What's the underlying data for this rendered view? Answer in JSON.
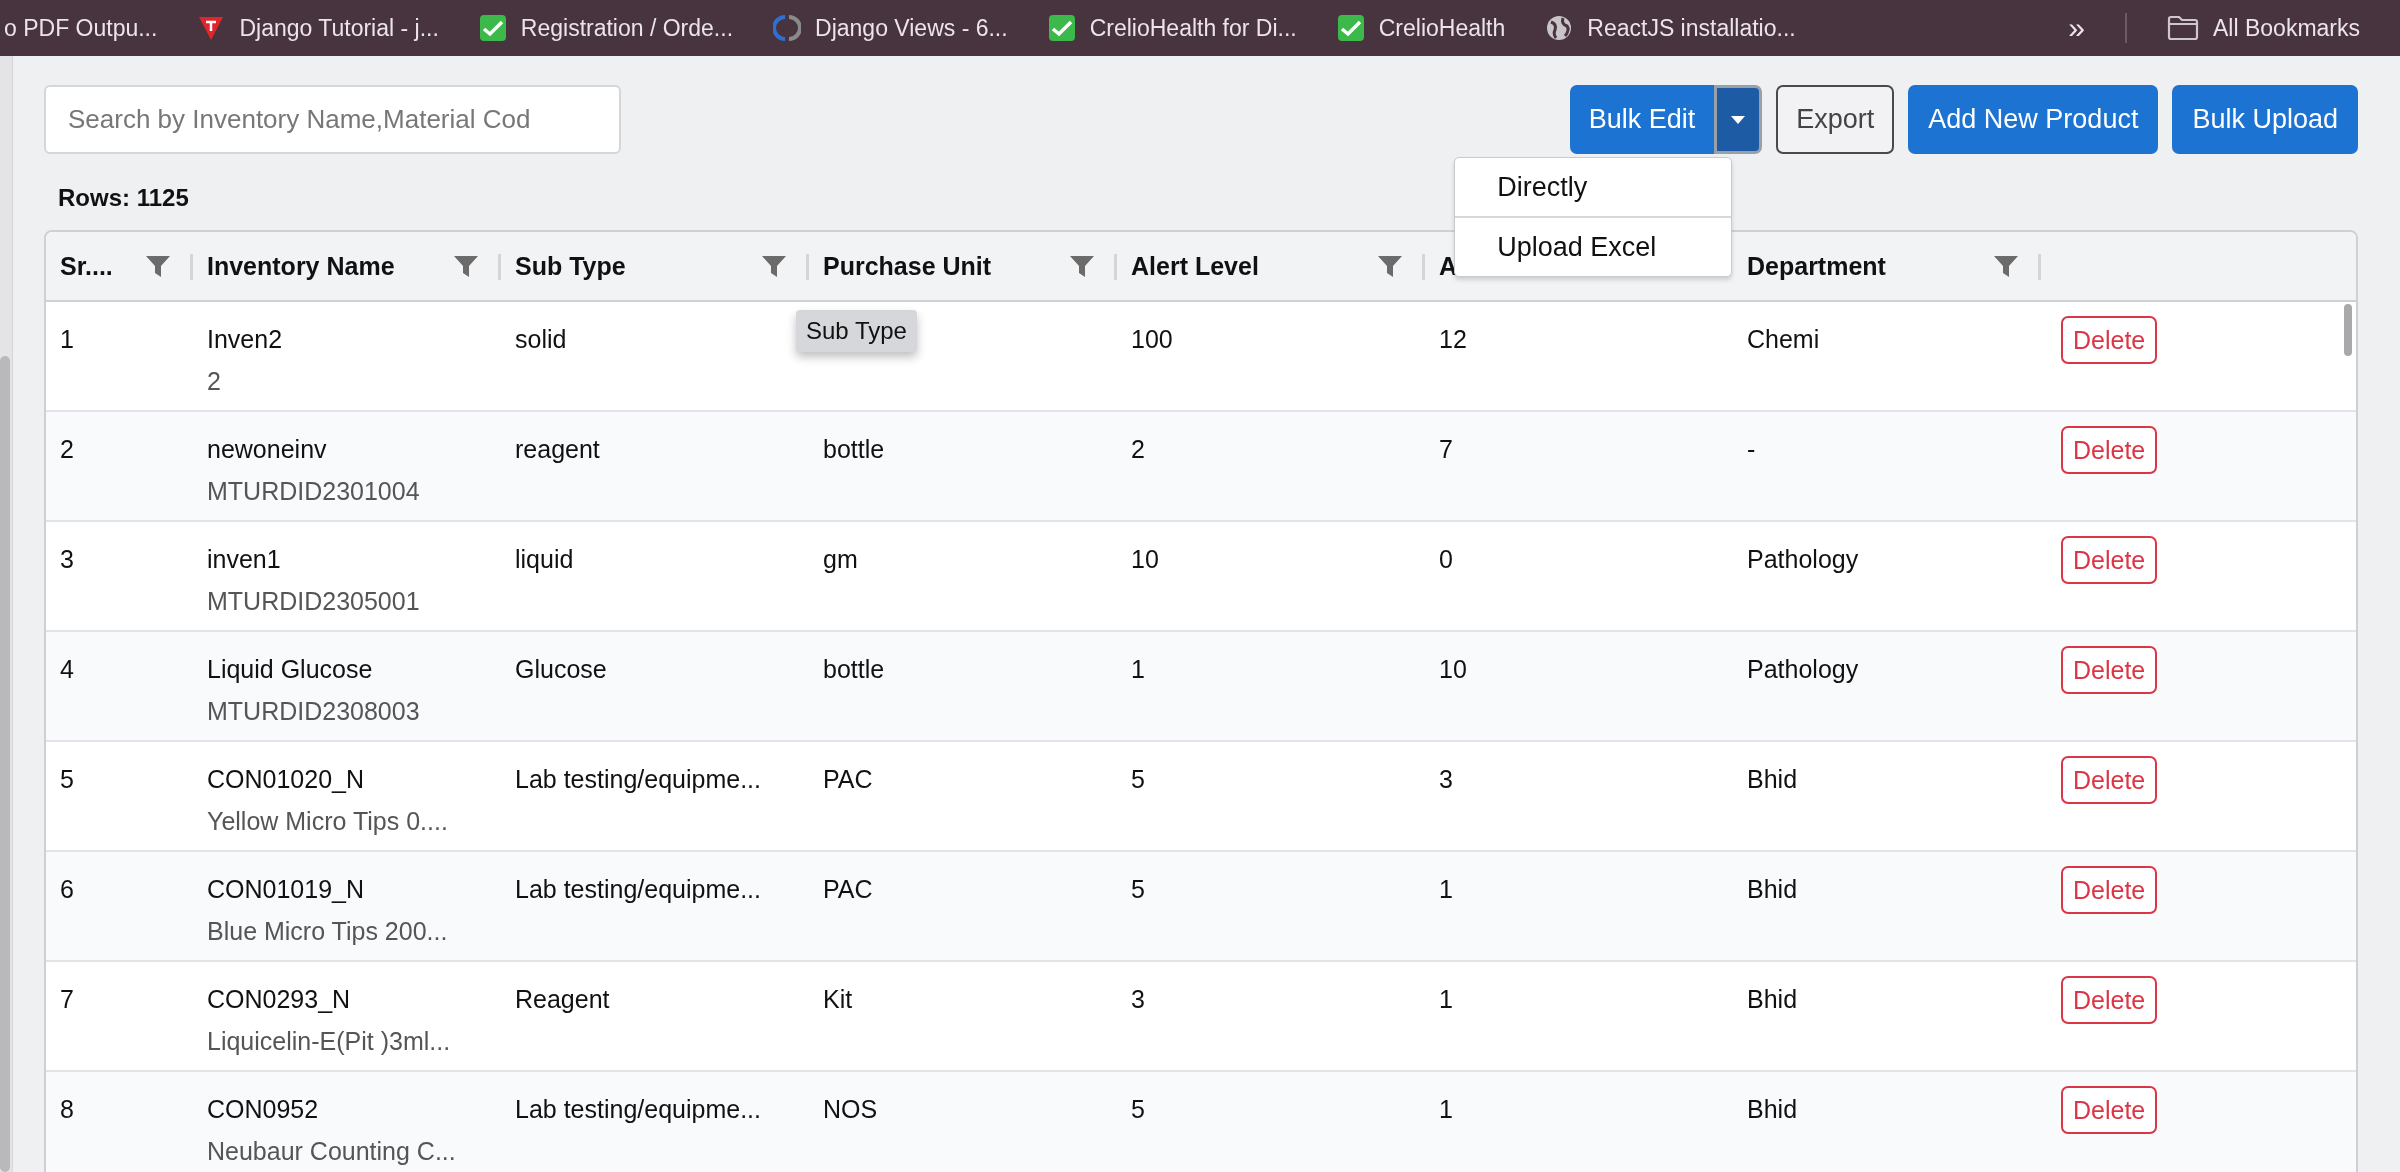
{
  "bookmarks_bar": {
    "items": [
      {
        "label": "o PDF Outpu...",
        "kind": "plain"
      },
      {
        "label": "Django Tutorial - j...",
        "kind": "triangle"
      },
      {
        "label": "Registration / Orde...",
        "kind": "check"
      },
      {
        "label": "Django Views - 6...",
        "kind": "swirl"
      },
      {
        "label": "CrelioHealth for Di...",
        "kind": "check"
      },
      {
        "label": "CrelioHealth",
        "kind": "check"
      },
      {
        "label": "ReactJS installatio...",
        "kind": "globe"
      }
    ],
    "overflow": "»",
    "all_bookmarks": "All Bookmarks"
  },
  "search": {
    "placeholder": "Search by Inventory Name,Material Cod"
  },
  "toolbar": {
    "bulk_edit": {
      "label": "Bulk Edit",
      "expanded": true,
      "menu": [
        "Directly",
        "Upload Excel"
      ]
    },
    "export": "Export",
    "add_new_product": "Add New Product",
    "bulk_upload": "Bulk Upload"
  },
  "rows_count": "Rows: 1125",
  "table": {
    "columns": [
      {
        "label": "Sr....",
        "filterable": true
      },
      {
        "label": "Inventory Name",
        "filterable": true
      },
      {
        "label": "Sub Type",
        "filterable": true
      },
      {
        "label": "Purchase Unit",
        "filterable": true
      },
      {
        "label": "Alert Level",
        "filterable": true
      },
      {
        "label": "A",
        "filterable": false
      },
      {
        "label": "Department",
        "filterable": true
      },
      {
        "filterable": false
      }
    ],
    "tooltip": "Sub Type",
    "rows": [
      {
        "sr": "1",
        "name": "Inven2",
        "code": "2",
        "sub_type": "solid",
        "alert_level": "100",
        "column_6": "12",
        "department": "Chemi",
        "action": "Delete"
      },
      {
        "sr": "2",
        "name": "newoneinv",
        "code": "MTURDID2301004",
        "sub_type": "reagent",
        "purchase_unit": "bottle",
        "alert_level": "2",
        "column_6": "7",
        "department": "-",
        "action": "Delete"
      },
      {
        "sr": "3",
        "name": "inven1",
        "code": "MTURDID2305001",
        "sub_type": "liquid",
        "purchase_unit": "gm",
        "alert_level": "10",
        "column_6": "0",
        "department": "Pathology",
        "action": "Delete"
      },
      {
        "sr": "4",
        "name": "Liquid Glucose",
        "code": "MTURDID2308003",
        "sub_type": "Glucose",
        "purchase_unit": "bottle",
        "alert_level": "1",
        "column_6": "10",
        "department": "Pathology",
        "action": "Delete"
      },
      {
        "sr": "5",
        "name": "CON01020_N",
        "code": "Yellow Micro Tips 0....",
        "sub_type": "Lab testing/equipme...",
        "purchase_unit": "PAC",
        "alert_level": "5",
        "column_6": "3",
        "department": "Bhid",
        "action": "Delete"
      },
      {
        "sr": "6",
        "name": "CON01019_N",
        "code": "Blue Micro Tips 200...",
        "sub_type": "Lab testing/equipme...",
        "purchase_unit": "PAC",
        "alert_level": "5",
        "column_6": "1",
        "department": "Bhid",
        "action": "Delete"
      },
      {
        "sr": "7",
        "name": "CON0293_N",
        "code": "Liquicelin-E(Pit )3ml...",
        "sub_type": "Reagent",
        "purchase_unit": "Kit",
        "alert_level": "3",
        "column_6": "1",
        "department": "Bhid",
        "action": "Delete"
      },
      {
        "sr": "8",
        "name": "CON0952",
        "code": "Neubaur Counting C...",
        "sub_type": "Lab testing/equipme...",
        "purchase_unit": "NOS",
        "alert_level": "5",
        "column_6": "1",
        "department": "Bhid",
        "action": "Delete"
      }
    ]
  }
}
